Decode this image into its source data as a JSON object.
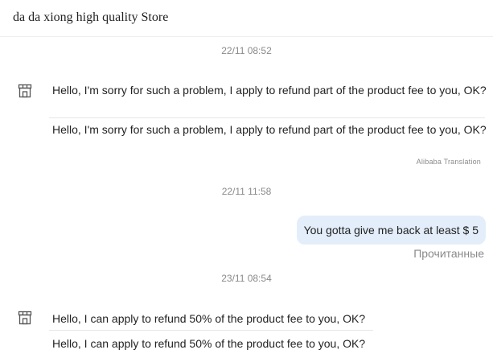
{
  "header": {
    "store_name": "da da xiong high quality Store"
  },
  "messages": [
    {
      "timestamp": "22/11 08:52",
      "text": "Hello, I'm sorry for such a problem, I apply to refund part of the product fee to you, OK?",
      "translated_text": "Hello, I'm sorry for such a problem, I apply to refund part of the product fee to you, OK?",
      "translation_note": "Alibaba Translation"
    },
    {
      "timestamp": "22/11 11:58",
      "text": "You gotta give me back at least $ 5",
      "status": "Прочитанные"
    },
    {
      "timestamp": "23/11 08:54",
      "text": "Hello, I can apply to refund 50% of the product fee to you, OK?",
      "translated_text": "Hello, I can apply to refund 50% of the product fee to you, OK?"
    }
  ],
  "colors": {
    "outgoing_bubble": "#e3eefa",
    "timestamp_text": "#8a8a8a",
    "divider": "#e6e6e6"
  },
  "icons": {
    "store_avatar": "store-icon"
  }
}
